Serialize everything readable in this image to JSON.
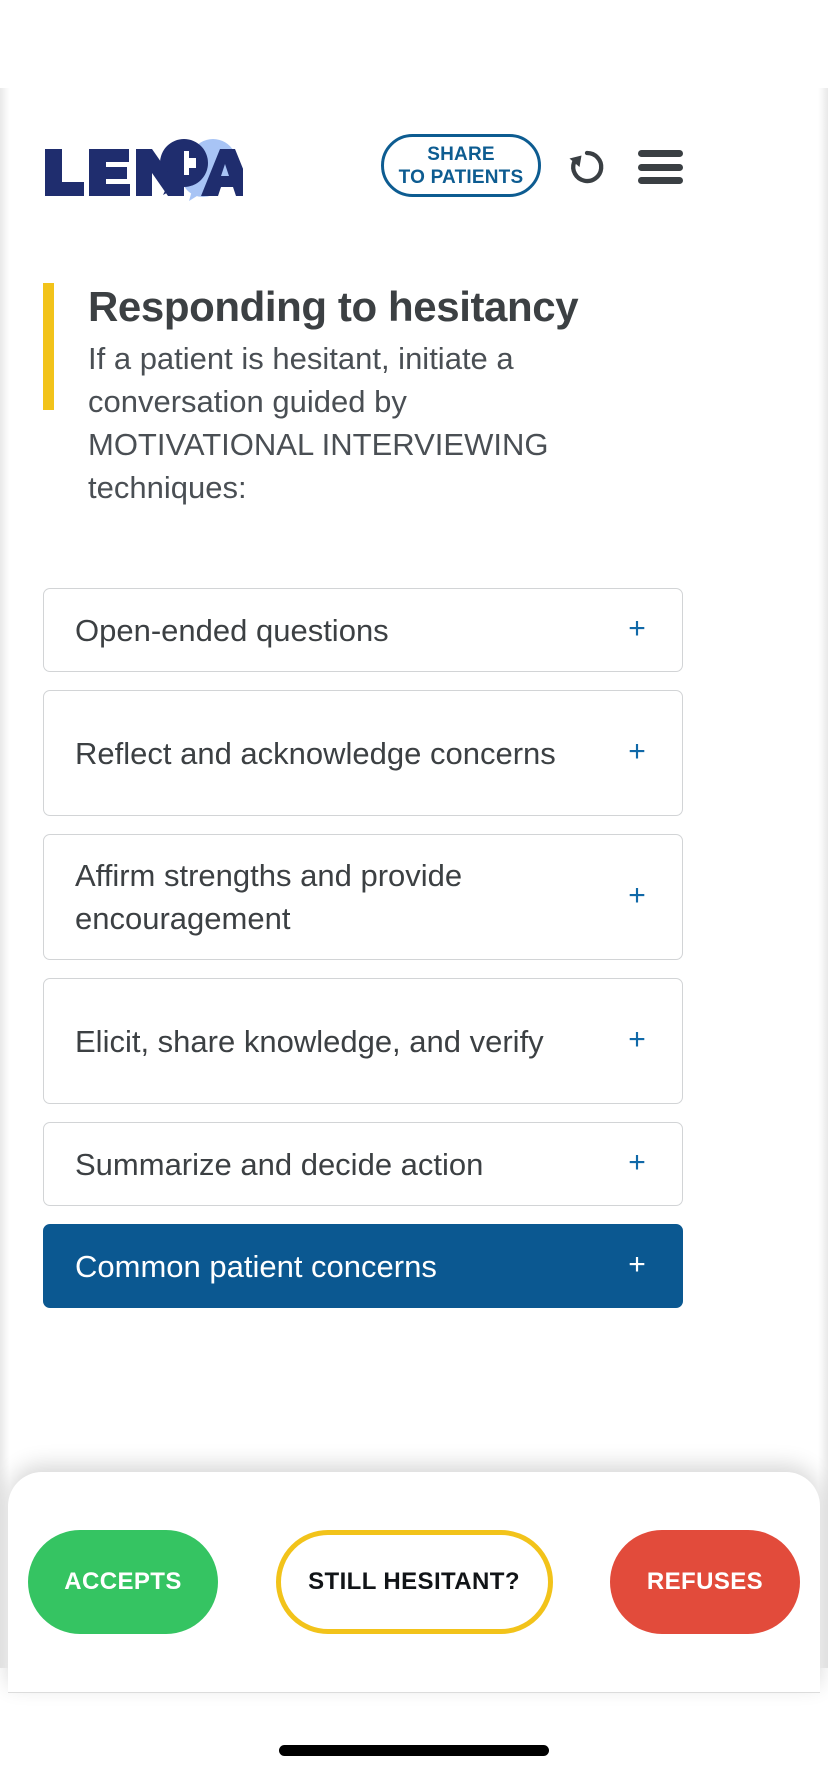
{
  "app": {
    "brand_name": "LENA",
    "colors": {
      "brand_navy": "#1F2D6E",
      "brand_light_blue": "#A8C4F5",
      "accent_blue": "#0D5C91",
      "accent_yellow": "#F2C31A",
      "dark_card_blue": "#0B5891",
      "accepts_green": "#35C462",
      "refuses_red": "#E24B3B",
      "text_dark": "#3c4043"
    }
  },
  "header": {
    "logo_name": "LENA",
    "share_button": {
      "line1": "SHARE",
      "line2": "TO PATIENTS"
    },
    "undo_icon": "undo-rotate-left-icon",
    "menu_icon": "hamburger-menu-icon"
  },
  "title_block": {
    "heading": "Responding to hesitancy",
    "description": "If a patient is hesitant, initiate a conversation guided by MOTIVATIONAL INTERVIEWING techniques:"
  },
  "accordion": {
    "expand_symbol": "+",
    "items": [
      {
        "label": "Open-ended questions",
        "lines": 1,
        "highlighted": false
      },
      {
        "label": "Reflect and acknowledge concerns",
        "lines": 2,
        "highlighted": false
      },
      {
        "label": "Affirm strengths and provide encouragement",
        "lines": 2,
        "highlighted": false
      },
      {
        "label": "Elicit, share knowledge, and verify",
        "lines": 2,
        "highlighted": false
      },
      {
        "label": "Summarize and decide action",
        "lines": 1,
        "highlighted": false
      },
      {
        "label": "Common patient concerns",
        "lines": 1,
        "highlighted": true
      }
    ]
  },
  "bottom_bar": {
    "accepts_label": "ACCEPTS",
    "hesitant_label": "STILL HESITANT?",
    "refuses_label": "REFUSES"
  }
}
